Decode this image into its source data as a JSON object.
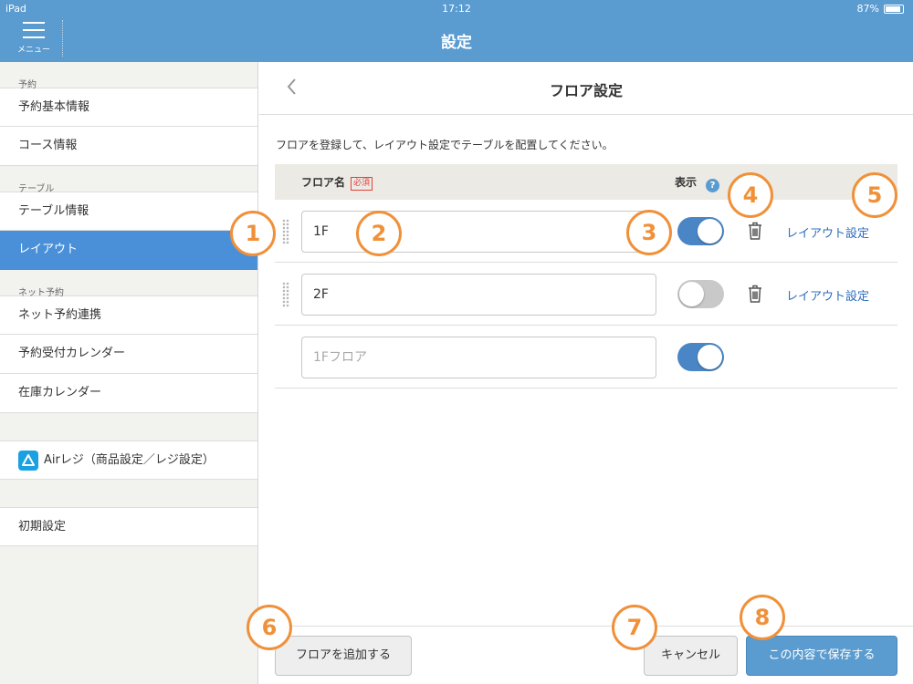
{
  "status_bar": {
    "device": "iPad",
    "time": "17:12",
    "battery": "87%"
  },
  "header": {
    "menu_label": "メニュー",
    "title": "設定"
  },
  "sidebar": {
    "sections": [
      {
        "label": "予約",
        "items": [
          "予約基本情報",
          "コース情報"
        ]
      },
      {
        "label": "テーブル",
        "items": [
          "テーブル情報",
          "レイアウト"
        ]
      },
      {
        "label": "ネット予約",
        "items": [
          "ネット予約連携",
          "予約受付カレンダー",
          "在庫カレンダー"
        ]
      }
    ],
    "active_item": "レイアウト",
    "air_item": "Airレジ（商品設定／レジ設定）",
    "initial_setting": "初期設定"
  },
  "main": {
    "title": "フロア設定",
    "description": "フロアを登録して、レイアウト設定でテーブルを配置してください。",
    "table_header": {
      "name": "フロア名",
      "required_badge": "必須",
      "show": "表示",
      "help": "?"
    },
    "rows": [
      {
        "value": "1F",
        "placeholder": "",
        "visible": true,
        "layout_link": "レイアウト設定"
      },
      {
        "value": "2F",
        "placeholder": "",
        "visible": false,
        "layout_link": "レイアウト設定"
      },
      {
        "value": "",
        "placeholder": "1Fフロア",
        "visible": true,
        "layout_link": ""
      }
    ]
  },
  "footer": {
    "add_floor": "フロアを追加する",
    "cancel": "キャンセル",
    "save": "この内容で保存する"
  },
  "annotations": [
    "1",
    "2",
    "3",
    "4",
    "5",
    "6",
    "7",
    "8"
  ],
  "colors": {
    "accent": "#5a9bd0",
    "active": "#4a90d9",
    "annotation": "#f0913a",
    "link": "#2d6dbd"
  }
}
